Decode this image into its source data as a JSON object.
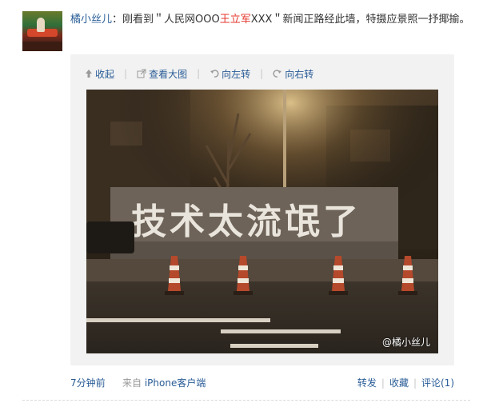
{
  "post": {
    "username": "橘小丝儿",
    "colon": "：",
    "text_1": "刚看到＂人民网OOO",
    "text_red": "王立军",
    "text_2": "XXX＂新闻正路经此墙，特摄应景照一抒揶揄。"
  },
  "toolbar": {
    "collapse": "收起",
    "view_large": "查看大图",
    "rotate_left": "向左转",
    "rotate_right": "向右转"
  },
  "photo": {
    "watermark": "@橘小丝儿",
    "graffiti": "技术太流氓了"
  },
  "meta": {
    "time": "7分钟前",
    "from_label": "来自",
    "source_app": "iPhone客户端",
    "repost": "转发",
    "favorite": "收藏",
    "comment": "评论(1)"
  },
  "colors": {
    "link": "#2a5d97",
    "highlight": "#e5332a",
    "muted": "#999999"
  }
}
